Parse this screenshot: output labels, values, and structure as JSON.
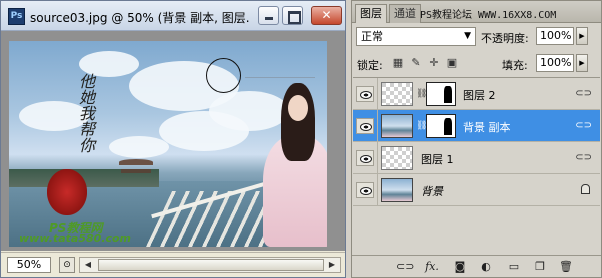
{
  "document": {
    "title": "source03.jpg @ 50% (背景 副本, 图层...",
    "zoom": "50%",
    "calligraphy": "他她我帮你",
    "watermark_brand": "PS教程网",
    "watermark_url": "www.tata580.com"
  },
  "window_controls": {
    "close_label": "✕"
  },
  "panel": {
    "tabs": [
      "图层",
      "通道"
    ],
    "header_watermark": "PS教程论坛 WWW.16XX8.COM",
    "blend_mode": "正常",
    "opacity_label": "不透明度:",
    "opacity_value": "100%",
    "lock_label": "锁定:",
    "fill_label": "填充:",
    "fill_value": "100%",
    "layers": [
      {
        "name": "图层 2",
        "visible": true,
        "has_mask": true,
        "selected": false
      },
      {
        "name": "背景 副本",
        "visible": true,
        "has_mask": true,
        "selected": true
      },
      {
        "name": "图层 1",
        "visible": true,
        "has_mask": false,
        "selected": false
      },
      {
        "name": "背景",
        "visible": true,
        "has_mask": false,
        "selected": false,
        "locked": true
      }
    ],
    "bottom_icons": [
      "link-icon",
      "fx-icon",
      "add-mask-icon",
      "adjustment-icon",
      "folder-icon",
      "new-layer-icon",
      "trash-icon"
    ]
  },
  "colors": {
    "selection": "#3f8fe4",
    "watermark_green": "#4f9a27",
    "seal_red": "#c72a28"
  }
}
